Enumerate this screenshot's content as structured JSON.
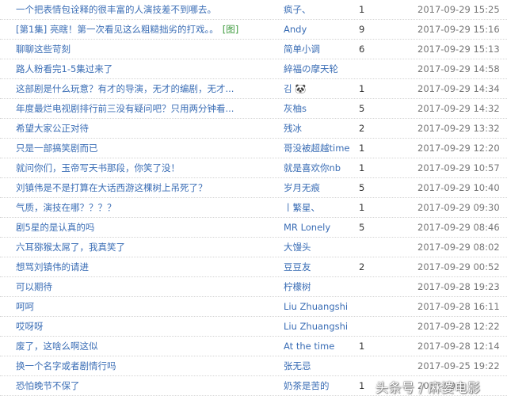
{
  "topics": [
    {
      "title": "一个把表情包诠释的很丰富的人演技差不到哪去。",
      "img_tag": "",
      "author": "疯子、",
      "replies": "1",
      "time": "2017-09-29 15:25"
    },
    {
      "title": "[第1集] 亮瞎！第一次看见这么粗糙拙劣的打戏。。",
      "img_tag": "[图]",
      "author": "Andy",
      "replies": "9",
      "time": "2017-09-29 15:16"
    },
    {
      "title": "聊聊这些苛刻",
      "img_tag": "",
      "author": "简单小调",
      "replies": "6",
      "time": "2017-09-29 15:13"
    },
    {
      "title": "路人粉看完1-5集过来了",
      "img_tag": "",
      "author": "綷福の摩天轮",
      "replies": "",
      "time": "2017-09-29 14:58"
    },
    {
      "title": "这部剧是什么玩意？有才的导演，无才的编剧，无才...",
      "img_tag": "",
      "author": "김 🐼",
      "replies": "1",
      "time": "2017-09-29 14:34"
    },
    {
      "title": "年度最烂电视剧排行前三没有疑问吧？只用两分钟看...",
      "img_tag": "",
      "author": "灰柚s",
      "replies": "5",
      "time": "2017-09-29 14:32"
    },
    {
      "title": "希望大家公正对待",
      "img_tag": "",
      "author": "残冰",
      "replies": "2",
      "time": "2017-09-29 13:32"
    },
    {
      "title": "只是一部搞笑剧而已",
      "img_tag": "",
      "author": "哥没被超越time",
      "replies": "1",
      "time": "2017-09-29 12:20"
    },
    {
      "title": "就问你们，玉帝写天书那段，你笑了没！",
      "img_tag": "",
      "author": "就是喜欢你nb",
      "replies": "1",
      "time": "2017-09-29 10:57"
    },
    {
      "title": "刘镇伟是不是打算在大话西游这棵树上吊死了？",
      "img_tag": "",
      "author": "岁月无痕",
      "replies": "5",
      "time": "2017-09-29 10:40"
    },
    {
      "title": "气质，演技在哪？？？？",
      "img_tag": "",
      "author": "丨繁星、",
      "replies": "1",
      "time": "2017-09-29 09:30"
    },
    {
      "title": "剧5星的是认真的吗",
      "img_tag": "",
      "author": "MR Lonely",
      "replies": "5",
      "time": "2017-09-29 08:46"
    },
    {
      "title": "六耳猕猴太屌了，我真笑了",
      "img_tag": "",
      "author": "大馒头",
      "replies": "",
      "time": "2017-09-29 08:02"
    },
    {
      "title": "想骂刘镇伟的请进",
      "img_tag": "",
      "author": "豆豆友",
      "replies": "2",
      "time": "2017-09-29 00:52"
    },
    {
      "title": "可以期待",
      "img_tag": "",
      "author": "柠檬树",
      "replies": "",
      "time": "2017-09-28 19:23"
    },
    {
      "title": "呵呵",
      "img_tag": "",
      "author": "Liu Zhuangshi",
      "replies": "",
      "time": "2017-09-28 16:11"
    },
    {
      "title": "哎呀呀",
      "img_tag": "",
      "author": "Liu Zhuangshi",
      "replies": "",
      "time": "2017-09-28 12:22"
    },
    {
      "title": "废了，这啥么啊这似",
      "img_tag": "",
      "author": "At the time",
      "replies": "1",
      "time": "2017-09-28 12:14"
    },
    {
      "title": "换一个名字或者剧情行吗",
      "img_tag": "",
      "author": "张无忌",
      "replies": "",
      "time": "2017-09-25 19:22"
    },
    {
      "title": "恐怕晚节不保了",
      "img_tag": "",
      "author": "奶茶是苦的",
      "replies": "1",
      "time": "2017-09-2"
    }
  ],
  "watermark": "头条号 / 麻婆电影"
}
